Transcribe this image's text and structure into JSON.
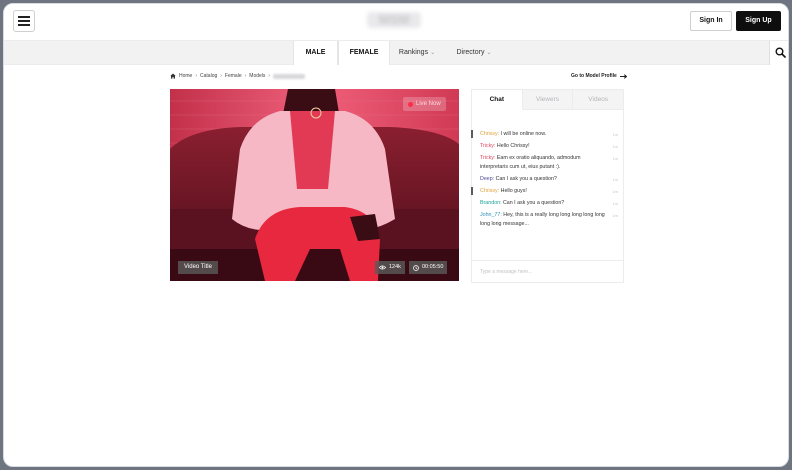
{
  "header": {
    "logo_text": "MSM",
    "sign_in_label": "Sign In",
    "sign_up_label": "Sign Up"
  },
  "nav": {
    "tabs": [
      {
        "label": "MALE",
        "active": true
      },
      {
        "label": "FEMALE",
        "active": true
      },
      {
        "label": "Rankings",
        "chevron": "⌄"
      },
      {
        "label": "Directory",
        "chevron": "⌄"
      }
    ],
    "search_icon": "search-icon"
  },
  "breadcrumb": {
    "items": [
      "Home",
      "Catalog",
      "Female",
      "Models"
    ],
    "separator": "›"
  },
  "model_profile_link": "Go to Model Profile",
  "video": {
    "live_label": "Live Now",
    "title": "Video Title",
    "views": "124k",
    "duration": "00:05:50"
  },
  "chat": {
    "tabs": [
      "Chat",
      "Viewers",
      "Videos"
    ],
    "active_tab": "Chat",
    "messages": [
      {
        "user": "Chrissy:",
        "text": "I will be online now.",
        "time": "1m",
        "color": "#e6a23c",
        "bar": true
      },
      {
        "user": "Tricky:",
        "text": "Hello Chrissy!",
        "time": "1m",
        "color": "#e0435c",
        "bar": false
      },
      {
        "user": "Tricky:",
        "text": "Eam ex oratio aliquando, admodum interpretaris cum ut, eius putant :).",
        "time": "1m",
        "color": "#e0435c",
        "bar": false
      },
      {
        "user": "Deep:",
        "text": "Can I ask you a question?",
        "time": "1m",
        "color": "#4a4a9a",
        "bar": false
      },
      {
        "user": "Chrissy:",
        "text": "Hello guys!",
        "time": "1m",
        "color": "#e6a23c",
        "bar": true
      },
      {
        "user": "Brandon:",
        "text": "Can I ask you a question?",
        "time": "1m",
        "color": "#1ba39c",
        "bar": false
      },
      {
        "user": "John_77:",
        "text": "Hey, this is a really long long long long long long long message...",
        "time": "1m",
        "color": "#2b8fb3",
        "bar": false
      }
    ],
    "input_placeholder": "Type a message here..."
  },
  "colors": {
    "accent_dark": "#0e0e0e",
    "live_red": "#ff2b4a"
  }
}
